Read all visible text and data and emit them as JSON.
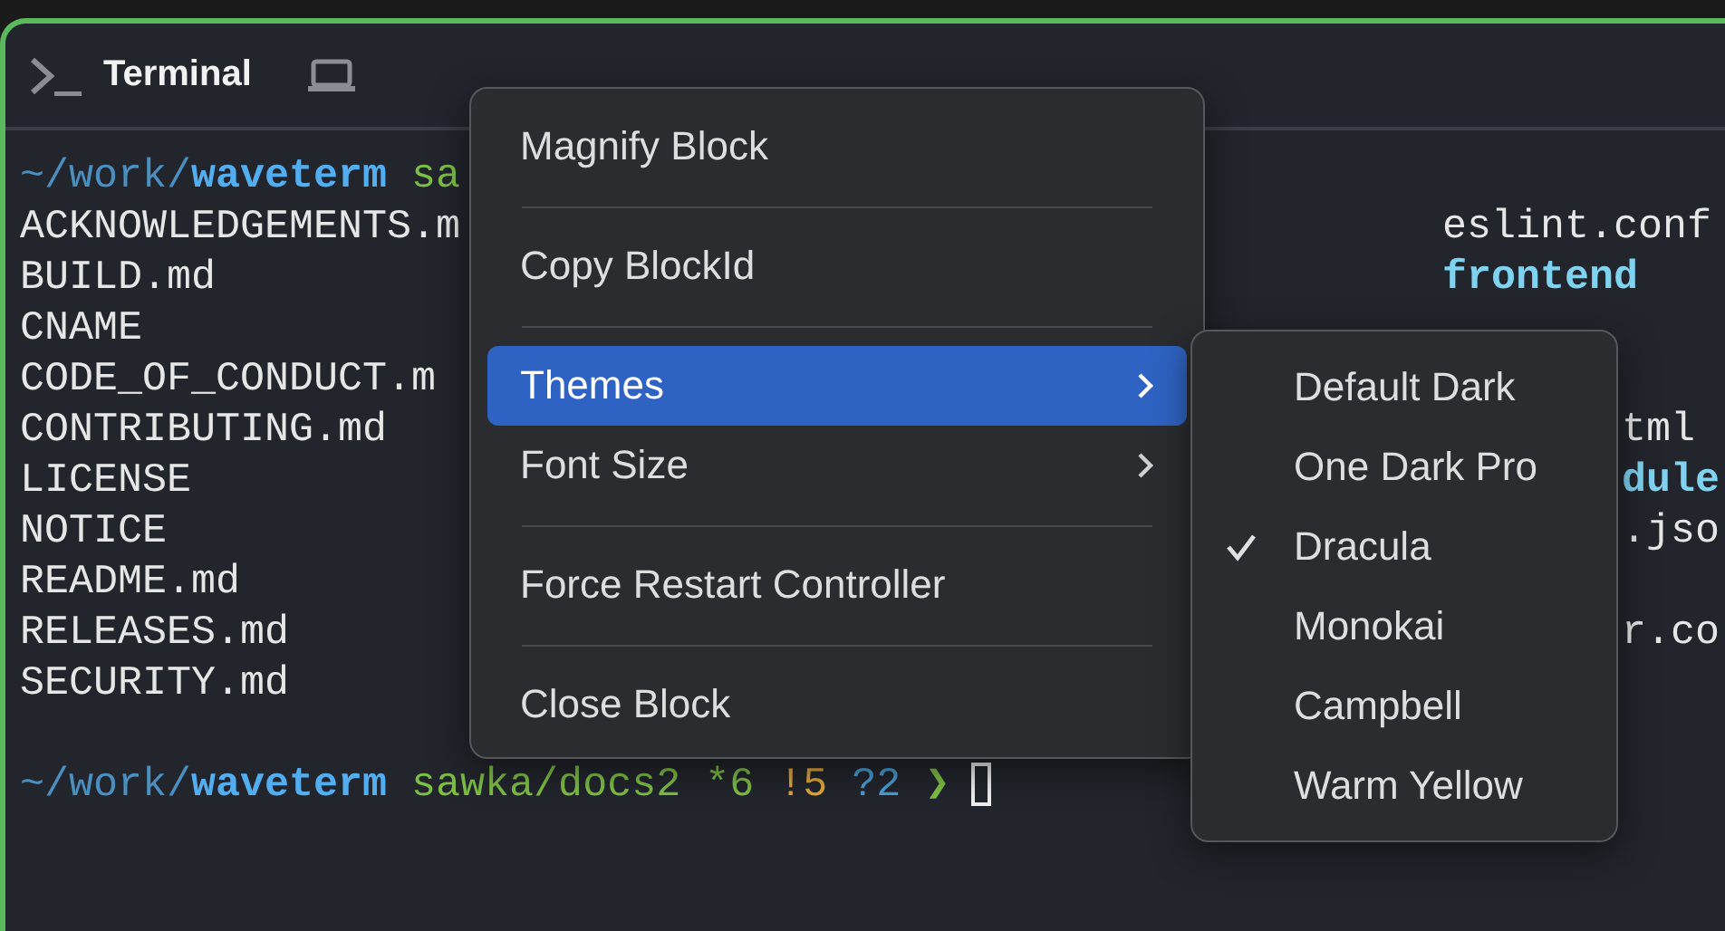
{
  "block": {
    "title": "Terminal"
  },
  "terminal": {
    "prompt_top": [
      {
        "text": "~/work/",
        "color": "#4a8fbf",
        "bold": false
      },
      {
        "text": "waveterm",
        "color": "#52aef0",
        "bold": true
      },
      {
        "text": " sa",
        "color": "#7ebf45",
        "bold": false
      }
    ],
    "rows": [
      {
        "left": "ACKNOWLEDGEMENTS.m",
        "right": {
          "text": "eslint.conf",
          "bold": false
        }
      },
      {
        "left": "BUILD.md",
        "right": {
          "text": "frontend",
          "bold": true
        }
      },
      {
        "left": "CNAME"
      },
      {
        "left": "CODE_OF_CONDUCT.m"
      },
      {
        "left": "CONTRIBUTING.md",
        "right": {
          "text": "tml",
          "bold": false
        }
      },
      {
        "left": "LICENSE",
        "right": {
          "text": "dule",
          "bold": true
        }
      },
      {
        "left": "NOTICE",
        "right": {
          "text": ".jso",
          "bold": false
        }
      },
      {
        "left": "README.md"
      },
      {
        "left": "RELEASES.md",
        "right": {
          "text": "r.co",
          "bold": false
        }
      },
      {
        "left": "SECURITY.md"
      }
    ],
    "prompt_bottom": [
      {
        "text": "~/work/",
        "color": "#4a8fbf",
        "bold": false
      },
      {
        "text": "waveterm",
        "color": "#52aef0",
        "bold": true
      },
      {
        "text": " sawka/docs2 *6",
        "color": "#7ebf45",
        "bold": false
      },
      {
        "text": " !5",
        "color": "#e2a73a",
        "bold": false
      },
      {
        "text": " ?2",
        "color": "#4a9fd4",
        "bold": false
      },
      {
        "text": " ❯",
        "color": "#7ebf45"
      }
    ]
  },
  "context_menu": {
    "items": [
      {
        "kind": "item",
        "label": "Magnify Block",
        "selected": false,
        "submenu": false
      },
      {
        "kind": "separator"
      },
      {
        "kind": "item",
        "label": "Copy BlockId",
        "selected": false,
        "submenu": false
      },
      {
        "kind": "separator"
      },
      {
        "kind": "item",
        "label": "Themes",
        "selected": true,
        "submenu": true
      },
      {
        "kind": "item",
        "label": "Font Size",
        "selected": false,
        "submenu": true
      },
      {
        "kind": "separator"
      },
      {
        "kind": "item",
        "label": "Force Restart Controller",
        "selected": false,
        "submenu": false
      },
      {
        "kind": "separator"
      },
      {
        "kind": "item",
        "label": "Close Block",
        "selected": false,
        "submenu": false
      }
    ]
  },
  "themes_menu": {
    "items": [
      {
        "label": "Default Dark",
        "checked": false
      },
      {
        "label": "One Dark Pro",
        "checked": false
      },
      {
        "label": "Dracula",
        "checked": true
      },
      {
        "label": "Monokai",
        "checked": false
      },
      {
        "label": "Campbell",
        "checked": false
      },
      {
        "label": "Warm Yellow",
        "checked": false
      }
    ]
  }
}
